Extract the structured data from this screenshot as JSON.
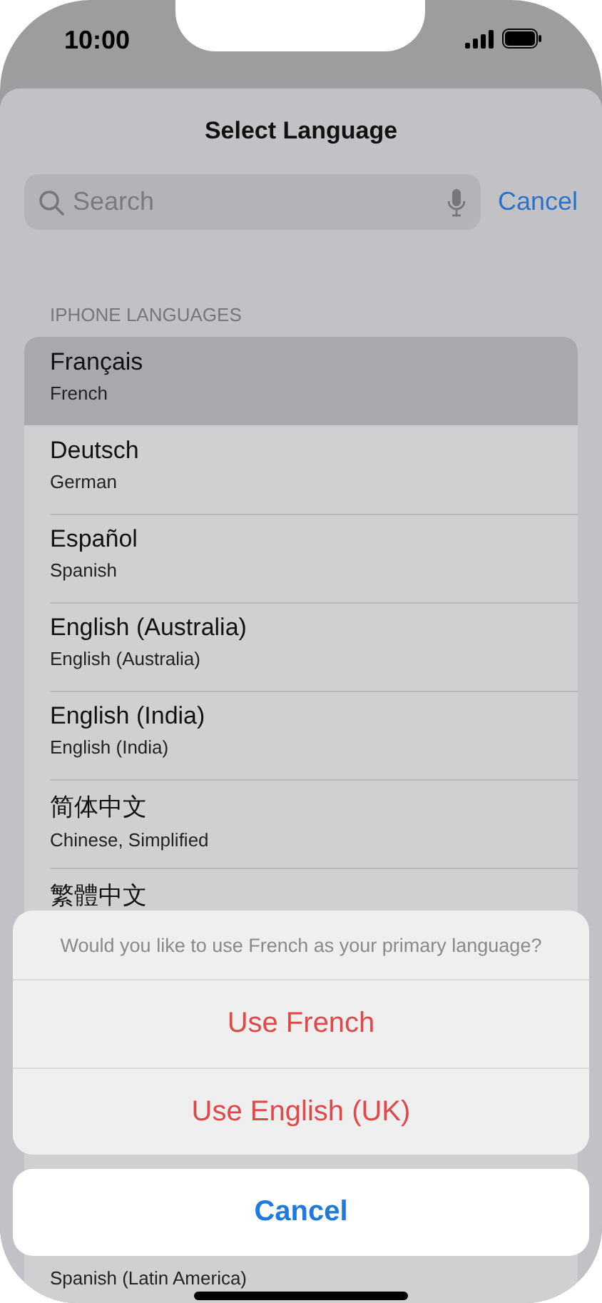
{
  "status_bar": {
    "time": "10:00"
  },
  "title": "Select Language",
  "search": {
    "placeholder": "Search"
  },
  "search_cancel": "Cancel",
  "section_header": "IPHONE LANGUAGES",
  "languages": [
    {
      "name": "Français",
      "subtitle": "French",
      "selected": true
    },
    {
      "name": "Deutsch",
      "subtitle": "German",
      "selected": false
    },
    {
      "name": "Español",
      "subtitle": "Spanish",
      "selected": false
    },
    {
      "name": "English (Australia)",
      "subtitle": "English (Australia)",
      "selected": false
    },
    {
      "name": "English (India)",
      "subtitle": "English (India)",
      "selected": false
    },
    {
      "name": "简体中文",
      "subtitle": "Chinese, Simplified",
      "selected": false
    },
    {
      "name": "繁體中文",
      "selected": false
    }
  ],
  "partial_row": {
    "subtitle": "Spanish (Latin America)"
  },
  "action_sheet": {
    "message": "Would you like to use French as your primary language?",
    "actions": [
      "Use French",
      "Use English (UK)"
    ],
    "cancel": "Cancel"
  }
}
